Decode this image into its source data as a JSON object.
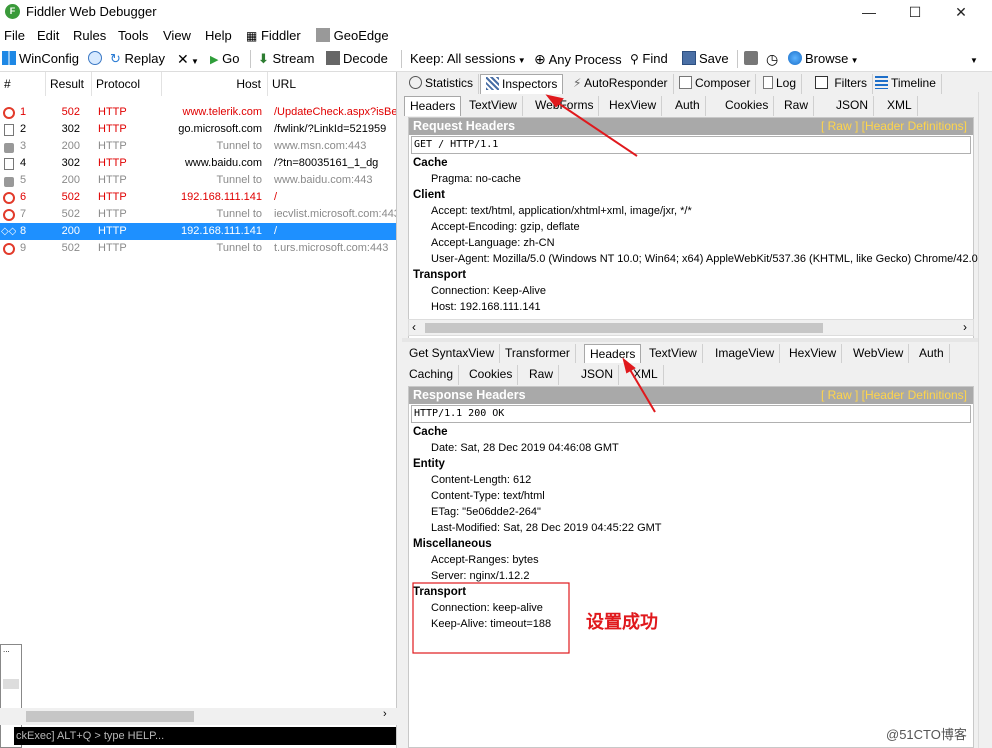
{
  "window": {
    "title": "Fiddler Web Debugger",
    "icon_letter": "F",
    "controls": [
      "—",
      "☐",
      "✕"
    ]
  },
  "menu": [
    "File",
    "Edit",
    "Rules",
    "Tools",
    "View",
    "Help",
    "Fiddler",
    "GeoEdge"
  ],
  "toolbar": {
    "winconfig": "WinConfig",
    "replay": "Replay",
    "go": "Go",
    "stream": "Stream",
    "decode": "Decode",
    "keep": "Keep: All sessions",
    "any_process": "Any Process",
    "find": "Find",
    "save": "Save",
    "browse": "Browse"
  },
  "sessions": {
    "columns": [
      "#",
      "Result",
      "Protocol",
      "Host",
      "URL"
    ],
    "rows": [
      {
        "num": "1",
        "result": "502",
        "protocol": "HTTP",
        "host": "www.telerik.com",
        "url": "/UpdateCheck.aspx?isBet",
        "kind": "err",
        "icon": "error-icon"
      },
      {
        "num": "2",
        "result": "302",
        "protocol": "HTTP",
        "host": "go.microsoft.com",
        "url": "/fwlink/?LinkId=521959",
        "kind": "normal",
        "icon": "document-icon"
      },
      {
        "num": "3",
        "result": "200",
        "protocol": "HTTP",
        "host": "Tunnel to",
        "url": "www.msn.com:443",
        "kind": "tunnel",
        "icon": "lock-icon"
      },
      {
        "num": "4",
        "result": "302",
        "protocol": "HTTP",
        "host": "www.baidu.com",
        "url": "/?tn=80035161_1_dg",
        "kind": "normal",
        "icon": "document-icon"
      },
      {
        "num": "5",
        "result": "200",
        "protocol": "HTTP",
        "host": "Tunnel to",
        "url": "www.baidu.com:443",
        "kind": "tunnel",
        "icon": "lock-icon"
      },
      {
        "num": "6",
        "result": "502",
        "protocol": "HTTP",
        "host": "192.168.111.141",
        "url": "/",
        "kind": "err",
        "icon": "error-icon"
      },
      {
        "num": "7",
        "result": "502",
        "protocol": "HTTP",
        "host": "Tunnel to",
        "url": "iecvlist.microsoft.com:443",
        "kind": "tunnel",
        "icon": "error-icon"
      },
      {
        "num": "8",
        "result": "200",
        "protocol": "HTTP",
        "host": "192.168.111.141",
        "url": "/",
        "kind": "selected",
        "icon": "arrows-icon"
      },
      {
        "num": "9",
        "result": "502",
        "protocol": "HTTP",
        "host": "Tunnel to",
        "url": "t.urs.microsoft.com:443",
        "kind": "tunnel",
        "icon": "error-icon"
      }
    ]
  },
  "quickexec": "ckExec] ALT+Q > type HELP...",
  "main_tabs": [
    "Statistics",
    "Inspectors",
    "AutoResponder",
    "Composer",
    "Log",
    "Filters",
    "Timeline"
  ],
  "request": {
    "tabs": [
      "Headers",
      "TextView",
      "WebForms",
      "HexView",
      "Auth",
      "Cookies",
      "Raw",
      "JSON",
      "XML"
    ],
    "bar_title": "Request Headers",
    "bar_links": "[ Raw ]   [Header Definitions]",
    "first_line": "GET / HTTP/1.1",
    "groups": [
      {
        "name": "Cache",
        "items": [
          "Pragma: no-cache"
        ]
      },
      {
        "name": "Client",
        "items": [
          "Accept: text/html, application/xhtml+xml, image/jxr, */*",
          "Accept-Encoding: gzip, deflate",
          "Accept-Language: zh-CN",
          "User-Agent: Mozilla/5.0 (Windows NT 10.0; Win64; x64) AppleWebKit/537.36 (KHTML, like Gecko) Chrome/42.0.2"
        ]
      },
      {
        "name": "Transport",
        "items": [
          "Connection: Keep-Alive",
          "Host: 192.168.111.141"
        ]
      }
    ]
  },
  "response": {
    "tabs_row1": [
      "Get SyntaxView",
      "Transformer",
      "Headers",
      "TextView",
      "ImageView",
      "HexView",
      "WebView",
      "Auth"
    ],
    "tabs_row2": [
      "Caching",
      "Cookies",
      "Raw",
      "JSON",
      "XML"
    ],
    "bar_title": "Response Headers",
    "bar_links": "[ Raw ]   [Header Definitions]",
    "first_line": "HTTP/1.1 200 OK",
    "groups": [
      {
        "name": "Cache",
        "items": [
          "Date: Sat, 28 Dec 2019 04:46:08 GMT"
        ]
      },
      {
        "name": "Entity",
        "items": [
          "Content-Length: 612",
          "Content-Type: text/html",
          "ETag: \"5e06dde2-264\"",
          "Last-Modified: Sat, 28 Dec 2019 04:45:22 GMT"
        ]
      },
      {
        "name": "Miscellaneous",
        "items": [
          "Accept-Ranges: bytes",
          "Server: nginx/1.12.2"
        ]
      },
      {
        "name": "Transport",
        "items": [
          "Connection: keep-alive",
          "Keep-Alive: timeout=188"
        ]
      }
    ]
  },
  "annotation": {
    "text": "设置成功",
    "color": "#e0191d"
  },
  "watermark": "@51CTO博客",
  "colors": {
    "selected_row": "#1e90ff",
    "error_text": "#e00000",
    "header_bar": "#a9a9a9",
    "header_links": "#ffd54a"
  }
}
